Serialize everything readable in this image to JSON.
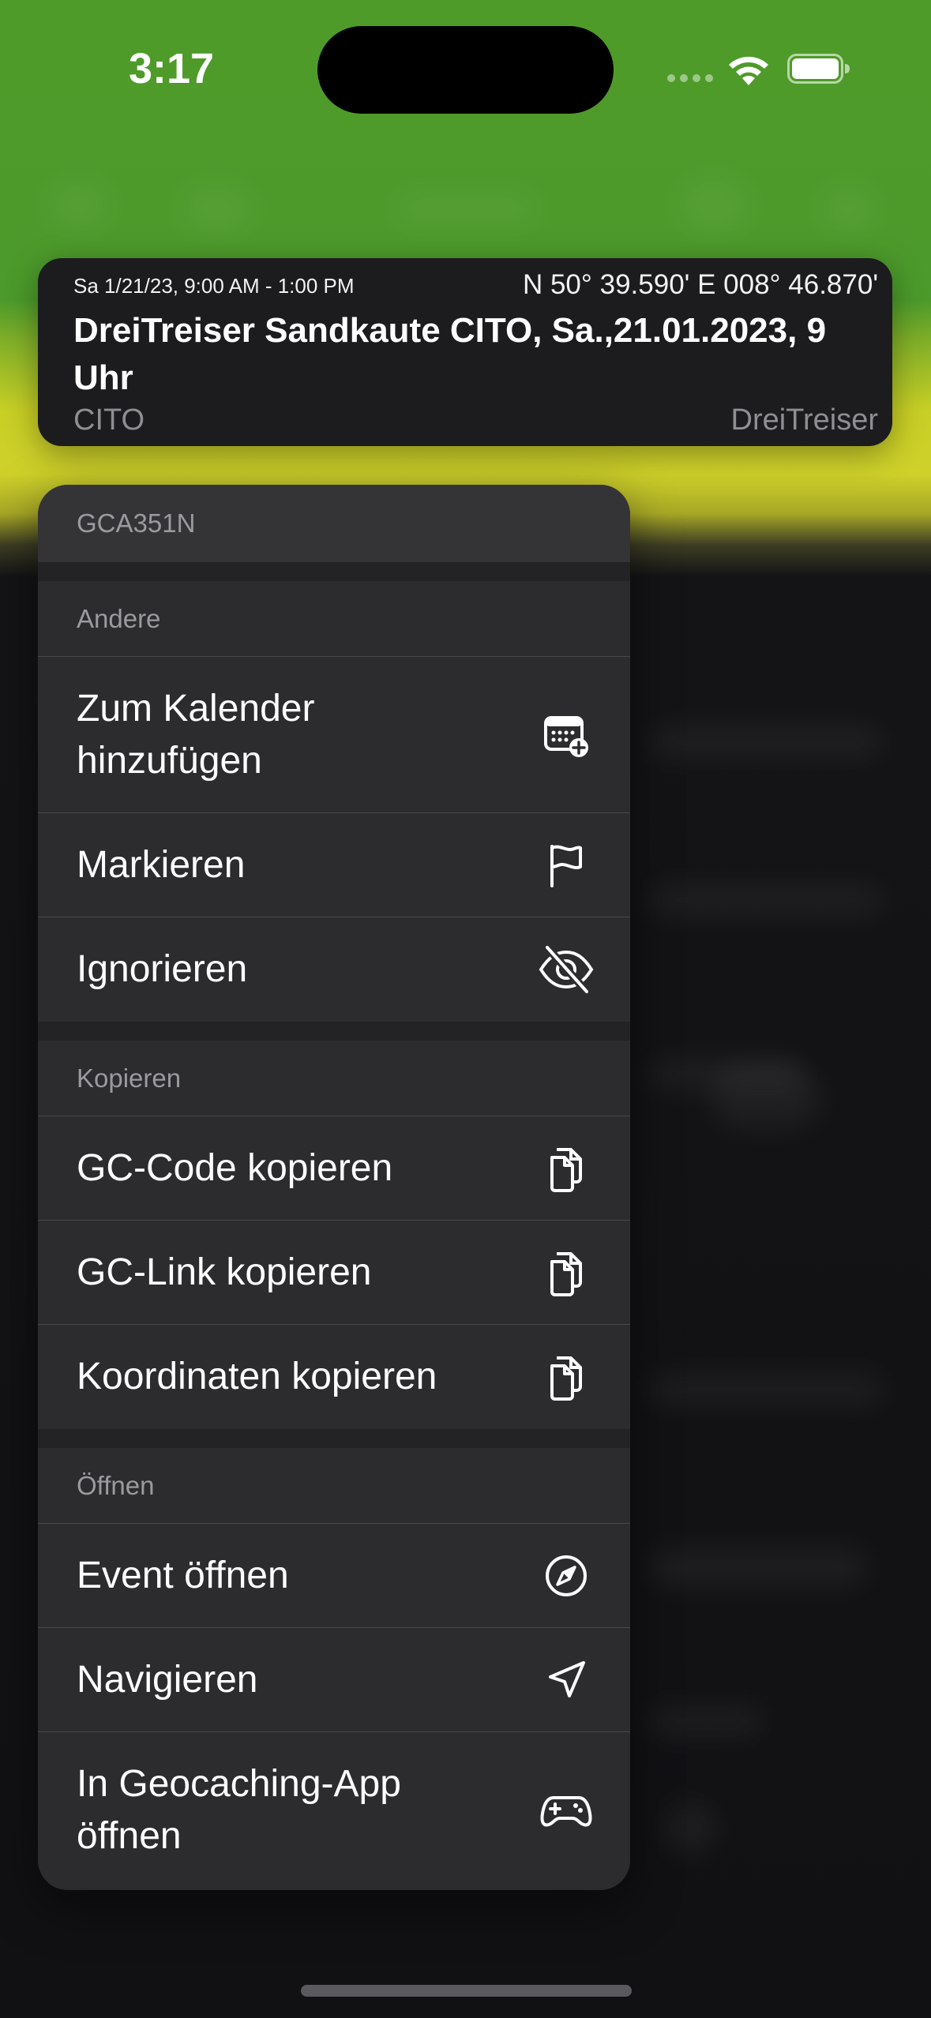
{
  "status_bar": {
    "time": "3:17",
    "icons": [
      "cellular-signal-icon",
      "wifi-icon",
      "battery-icon"
    ]
  },
  "preview_card": {
    "date_range": "Sa 1/21/23, 9:00 AM - 1:00 PM",
    "coordinates": "N 50° 39.590' E 008° 46.870'",
    "title": "DreiTreiser Sandkaute CITO, Sa.,21.01.2023, 9 Uhr",
    "type": "CITO",
    "owner": "DreiTreiser"
  },
  "menu": {
    "header": "GCA351N",
    "sections": [
      {
        "title": "Andere",
        "items": [
          {
            "label": "Zum Kalender hinzufügen",
            "icon": "calendar-add-icon"
          },
          {
            "label": "Markieren",
            "icon": "flag-icon"
          },
          {
            "label": "Ignorieren",
            "icon": "eye-slash-icon"
          }
        ]
      },
      {
        "title": "Kopieren",
        "items": [
          {
            "label": "GC-Code kopieren",
            "icon": "copy-icon"
          },
          {
            "label": "GC-Link kopieren",
            "icon": "copy-icon"
          },
          {
            "label": "Koordinaten kopieren",
            "icon": "copy-icon"
          }
        ]
      },
      {
        "title": "Öffnen",
        "items": [
          {
            "label": "Event öffnen",
            "icon": "compass-icon"
          },
          {
            "label": "Navigieren",
            "icon": "location-arrow-icon"
          },
          {
            "label": "In Geocaching-App öffnen",
            "icon": "gamecontroller-icon"
          }
        ]
      }
    ]
  },
  "colors": {
    "header_green": "#4f9b2a",
    "accent_yellow": "#cfd12a",
    "menu_background": "#2c2c2e",
    "card_background": "#1c1c1f",
    "secondary_text": "#8e8e93"
  }
}
